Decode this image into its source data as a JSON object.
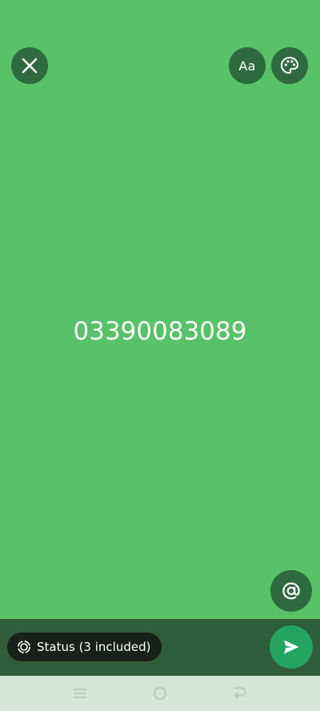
{
  "toolbar": {
    "close_icon": "close-icon",
    "font_label": "Aa",
    "palette_icon": "palette-icon"
  },
  "status_text": "03390083089",
  "mention_icon": "at-icon",
  "bottom_bar": {
    "audience_label": "Status (3 included)",
    "audience_icon": "status-icon",
    "send_icon": "send-icon"
  },
  "navigation": {
    "menu_icon": "menu-icon",
    "home_icon": "home-icon",
    "back_icon": "back-icon"
  },
  "colors": {
    "background": "#57c267",
    "button": "#2f6a3f",
    "bottom_bar": "#2f5c39",
    "send": "#23a55f",
    "nav_bar": "#d6e7d9"
  }
}
